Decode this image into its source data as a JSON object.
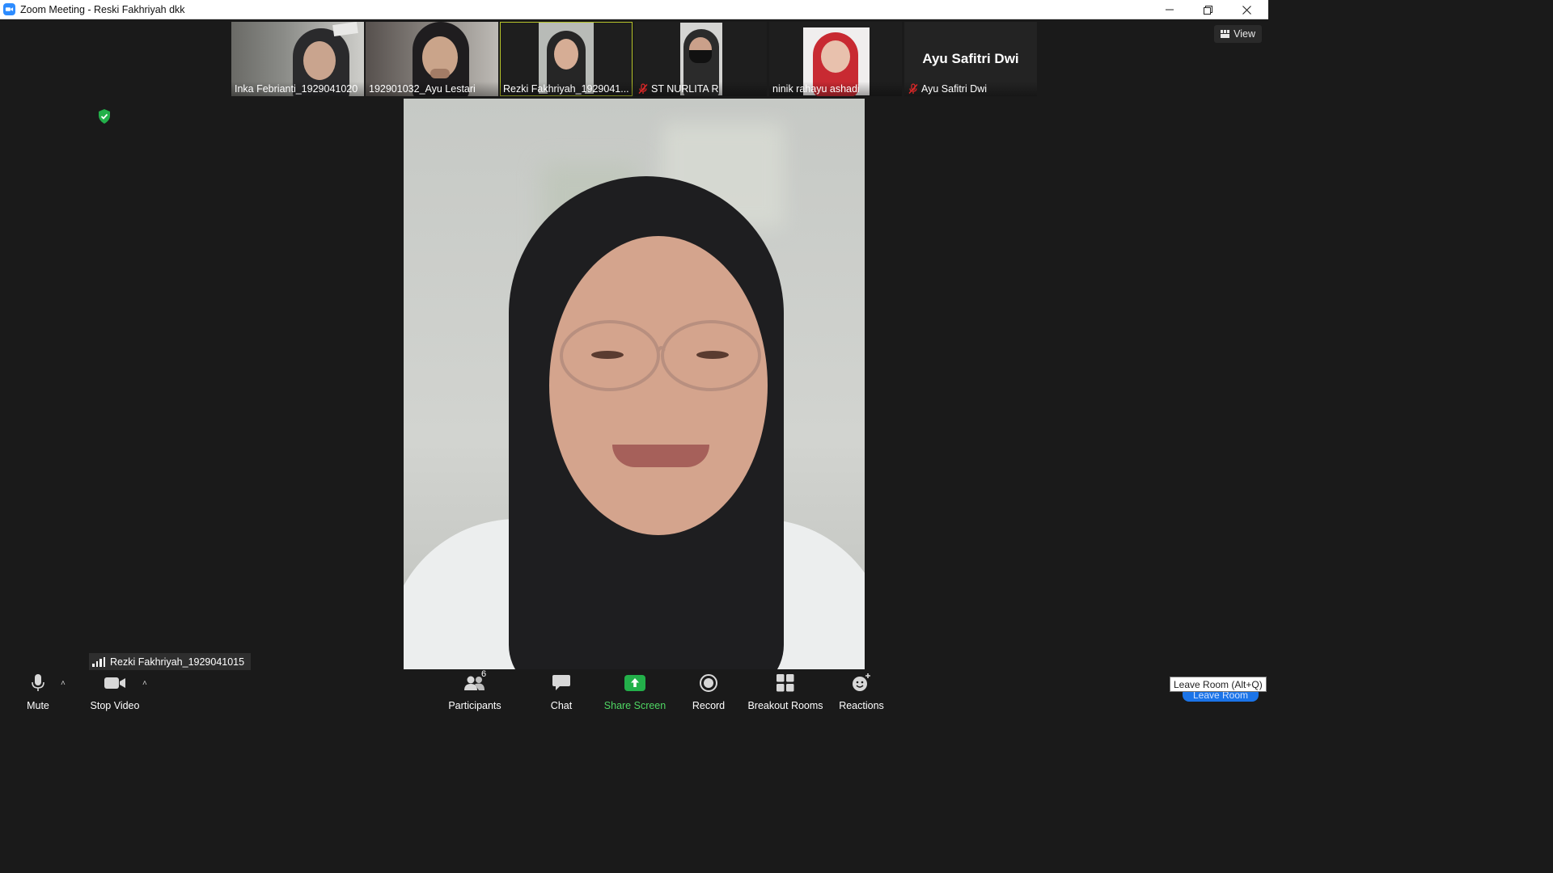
{
  "window": {
    "title": "Zoom Meeting - Reski Fakhriyah dkk",
    "controls": [
      "minimize-icon",
      "restore-icon",
      "close-icon"
    ]
  },
  "gallery": {
    "thumbnails": [
      {
        "name": "Inka Febrianti_1929041020",
        "muted": false,
        "active": false
      },
      {
        "name": "192901032_Ayu Lestari",
        "muted": false,
        "active": false
      },
      {
        "name": "Rezki Fakhriyah_1929041...",
        "muted": false,
        "active": true
      },
      {
        "name": "ST NURLITA R",
        "muted": true,
        "active": false
      },
      {
        "name": "ninik rahayu ashadi",
        "muted": false,
        "active": false
      },
      {
        "name": "Ayu Safitri Dwi",
        "muted": true,
        "active": false,
        "display_name": "Ayu Safitri Dwi"
      }
    ]
  },
  "view_button": {
    "label": "View"
  },
  "main_video": {
    "speaker_name": "Rezki Fakhriyah_1929041015"
  },
  "toolbar": {
    "mute_label": "Mute",
    "stop_video_label": "Stop Video",
    "participants_label": "Participants",
    "participants_count": "6",
    "chat_label": "Chat",
    "share_screen_label": "Share Screen",
    "record_label": "Record",
    "breakout_rooms_label": "Breakout Rooms",
    "reactions_label": "Reactions",
    "leave_label": "Leave Room"
  },
  "tooltip": {
    "text": "Leave Room (Alt+Q)"
  },
  "colors": {
    "accent_green": "#4fd663",
    "active_border": "#b5c229",
    "leave_blue": "#1b74e8",
    "muted_red": "#e02828"
  }
}
